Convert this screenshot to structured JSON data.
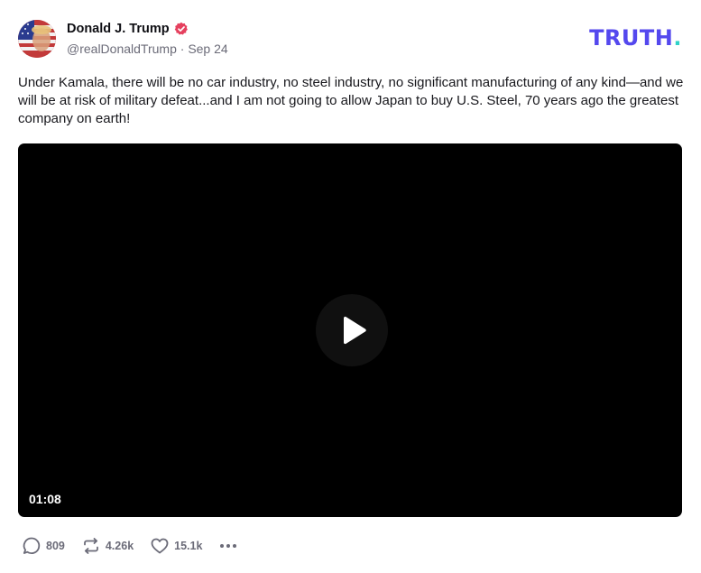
{
  "author": {
    "display_name": "Donald J. Trump",
    "verified_icon": "verified-badge-icon",
    "handle": "@realDonaldTrump",
    "separator": " · ",
    "date": "Sep 24"
  },
  "brand": {
    "text": "TRUTH",
    "dot": ".",
    "color": "#5448ee",
    "dot_color": "#2fd2c8"
  },
  "post": {
    "text": "Under Kamala, there will be no car industry, no steel industry, no significant manufacturing of any kind—and we will be at risk of military defeat...and I am not going to allow Japan to buy U.S. Steel, 70 years ago the greatest company on earth!"
  },
  "video": {
    "duration": "01:08",
    "play_icon": "play-icon"
  },
  "actions": {
    "reply": {
      "icon": "reply-icon",
      "count": "809"
    },
    "retruth": {
      "icon": "retruth-icon",
      "count": "4.26k"
    },
    "like": {
      "icon": "heart-icon",
      "count": "15.1k"
    },
    "more": {
      "icon": "more-icon"
    }
  },
  "colors": {
    "verified_badge": "#e5405e",
    "muted_text": "#6b6b78"
  }
}
